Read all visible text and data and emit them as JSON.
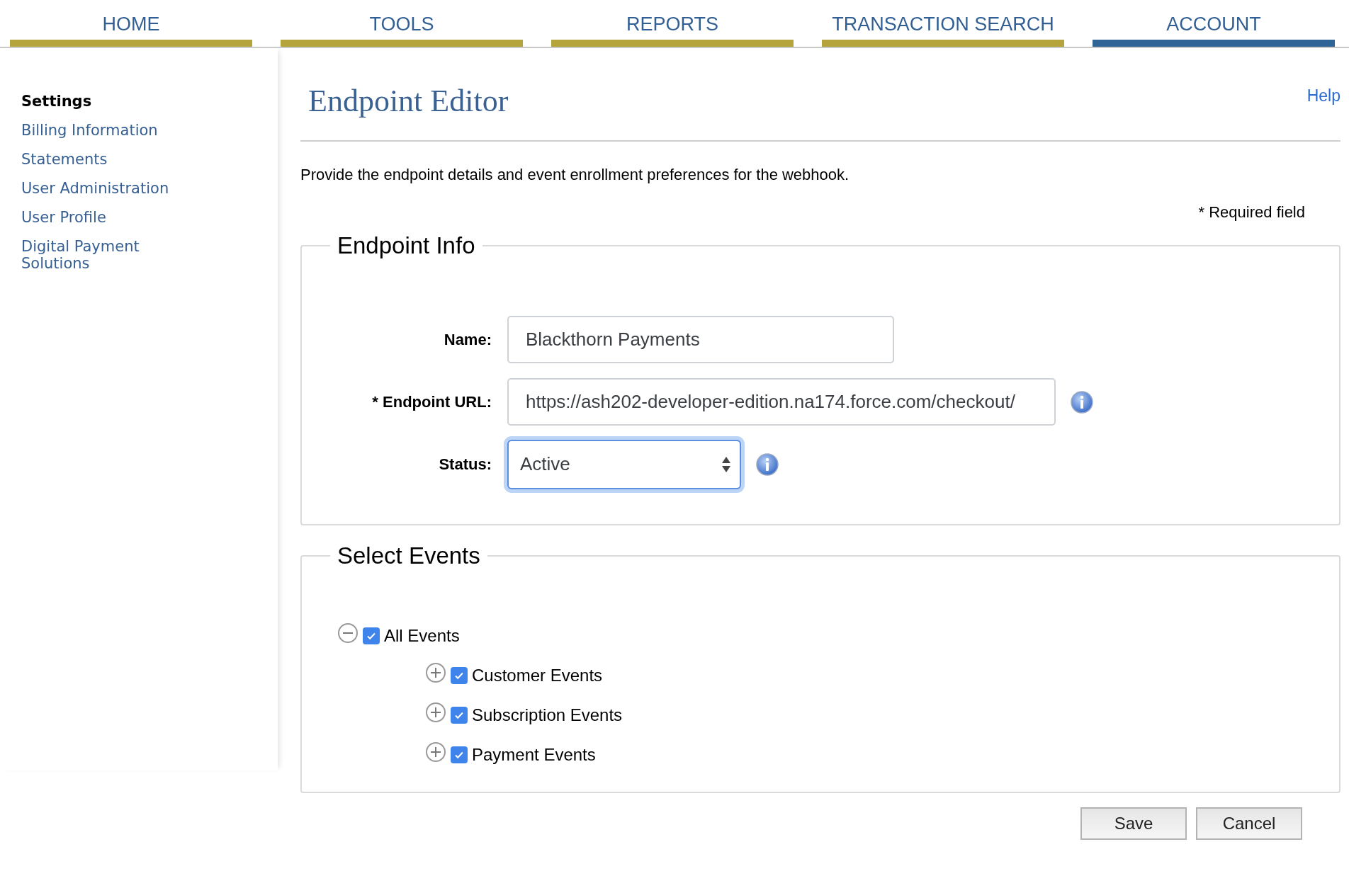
{
  "nav_tabs": [
    {
      "label": "HOME",
      "selected": false
    },
    {
      "label": "TOOLS",
      "selected": false
    },
    {
      "label": "REPORTS",
      "selected": false
    },
    {
      "label": "TRANSACTION SEARCH",
      "selected": false
    },
    {
      "label": "ACCOUNT",
      "selected": true
    }
  ],
  "sidebar": {
    "heading": "Settings",
    "items": [
      {
        "label": "Billing Information"
      },
      {
        "label": "Statements"
      },
      {
        "label": "User Administration"
      },
      {
        "label": "User Profile"
      },
      {
        "label": "Digital Payment Solutions"
      }
    ]
  },
  "page": {
    "title": "Endpoint Editor",
    "help_link": "Help",
    "description": "Provide the endpoint details and event enrollment preferences for the webhook.",
    "required_note": "* Required field"
  },
  "endpoint_info": {
    "legend": "Endpoint Info",
    "fields": [
      {
        "kind": "text",
        "label": "Name:",
        "value": "Blackthorn Payments",
        "info": false
      },
      {
        "kind": "text",
        "label": "* Endpoint URL:",
        "value": "https://ash202-developer-edition.na174.force.com/checkout/",
        "info": true
      },
      {
        "kind": "select",
        "label": "Status:",
        "value": "Active",
        "info": true,
        "focused": true
      }
    ]
  },
  "select_events": {
    "legend": "Select Events",
    "tree": [
      {
        "label": "All Events",
        "expanded": true,
        "checked": true,
        "children": [
          {
            "label": "Customer Events",
            "expanded": false,
            "checked": true
          },
          {
            "label": "Subscription Events",
            "expanded": false,
            "checked": true
          },
          {
            "label": "Payment Events",
            "expanded": false,
            "checked": true
          }
        ]
      }
    ]
  },
  "buttons": [
    {
      "label": "Save"
    },
    {
      "label": "Cancel"
    }
  ]
}
